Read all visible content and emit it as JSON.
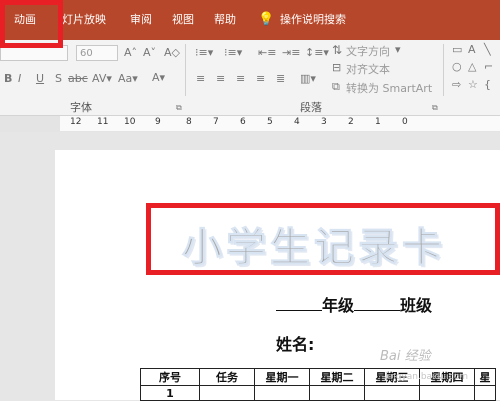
{
  "tabs": [
    "动画",
    "灯片放映",
    "审阅",
    "视图",
    "帮助"
  ],
  "search_label": "操作说明搜索",
  "font_size": "60",
  "font_group_label": "字体",
  "paragraph_group_label": "段落",
  "text_direction": "文字方向",
  "align_text": "对齐文本",
  "convert_smartart": "转换为 SmartArt",
  "ruler_numbers": [
    "12",
    "11",
    "10",
    "9",
    "8",
    "7",
    "6",
    "5",
    "4",
    "3",
    "2",
    "1",
    "0"
  ],
  "wordart_title": "小学生记录卡",
  "grade_line": "年级",
  "class_line": "班级",
  "name_label": "姓名:",
  "table_headers": [
    "序号",
    "任务",
    "星期一",
    "星期二",
    "星期三",
    "星期四",
    "星"
  ],
  "table_first_cell": "1",
  "watermark": "Bai 经验",
  "watermark_sub": "jingyan.baidu.com",
  "accent_colors": {
    "ribbon": "#b7472a",
    "highlight": "#e81f25",
    "wordart": "#a6a6a6"
  }
}
